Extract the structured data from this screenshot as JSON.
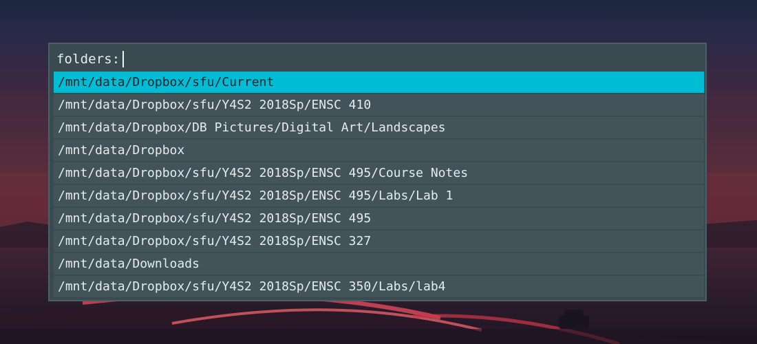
{
  "colors": {
    "panel_bg": "#3a4a51",
    "row_bg": "#425359",
    "selected_bg": "#00bcd4",
    "text": "#e6ecee"
  },
  "launcher": {
    "prompt": "folders:",
    "query": "",
    "selected_index": 0,
    "results": [
      "/mnt/data/Dropbox/sfu/Current",
      "/mnt/data/Dropbox/sfu/Y4S2 2018Sp/ENSC 410",
      "/mnt/data/Dropbox/DB Pictures/Digital Art/Landscapes",
      "/mnt/data/Dropbox",
      "/mnt/data/Dropbox/sfu/Y4S2 2018Sp/ENSC 495/Course Notes",
      "/mnt/data/Dropbox/sfu/Y4S2 2018Sp/ENSC 495/Labs/Lab 1",
      "/mnt/data/Dropbox/sfu/Y4S2 2018Sp/ENSC 495",
      "/mnt/data/Dropbox/sfu/Y4S2 2018Sp/ENSC 327",
      "/mnt/data/Downloads",
      "/mnt/data/Dropbox/sfu/Y4S2 2018Sp/ENSC 350/Labs/lab4"
    ]
  }
}
